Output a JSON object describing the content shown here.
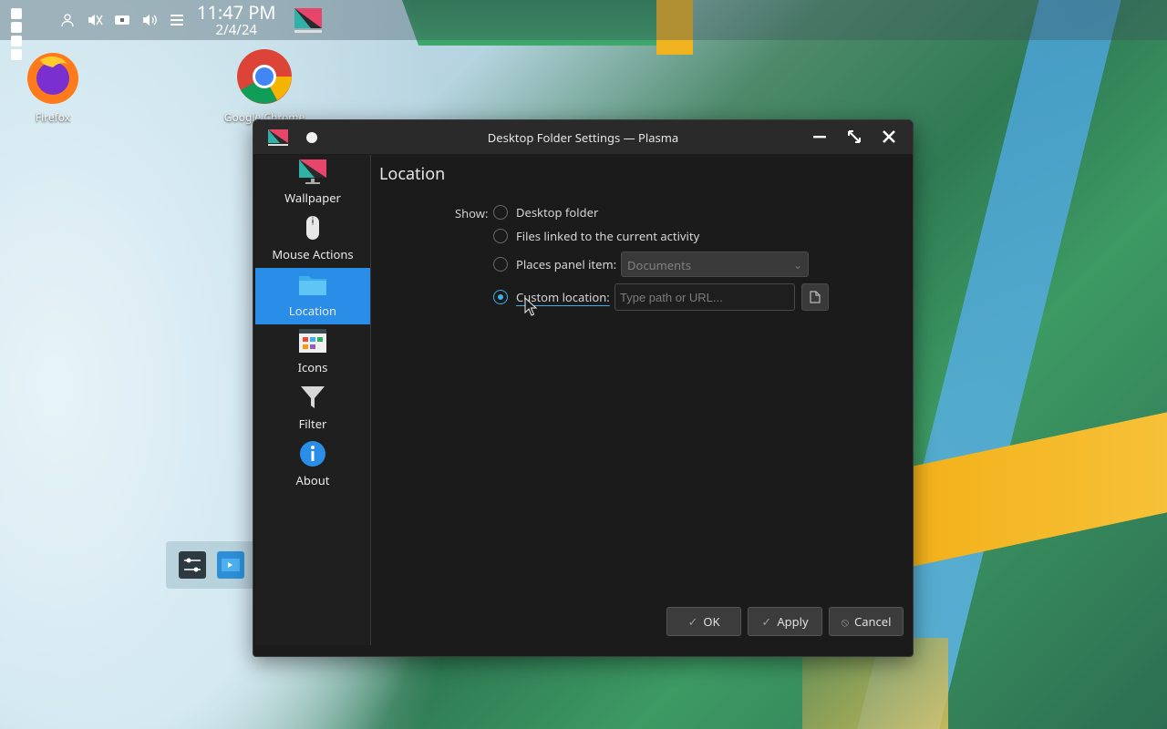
{
  "panel": {
    "time": "11:47 PM",
    "date": "2/4/24",
    "tray_icons": [
      "user-icon",
      "mute-icon",
      "network-icon",
      "volume-icon",
      "menu-icon"
    ]
  },
  "desktop": {
    "icons": [
      {
        "label": "Firefox",
        "icon": "firefox-icon"
      },
      {
        "label": "Google Chrome",
        "icon": "chrome-icon"
      }
    ]
  },
  "dialog": {
    "title": "Desktop Folder Settings — Plasma",
    "sidebar": [
      {
        "label": "Wallpaper",
        "icon": "wallpaper-icon",
        "active": false
      },
      {
        "label": "Mouse Actions",
        "icon": "mouse-icon",
        "active": false
      },
      {
        "label": "Location",
        "icon": "folder-icon",
        "active": true
      },
      {
        "label": "Icons",
        "icon": "icons-icon",
        "active": false
      },
      {
        "label": "Filter",
        "icon": "filter-icon",
        "active": false
      },
      {
        "label": "About",
        "icon": "info-icon",
        "active": false
      }
    ],
    "page_title": "Location",
    "show_label": "Show:",
    "options": {
      "desktop_folder": "Desktop folder",
      "files_linked": "Files linked to the current activity",
      "places_panel": "Places panel item:",
      "custom_location": "Custom location:"
    },
    "selected_option": "custom_location",
    "places_combo_value": "Documents",
    "custom_path_placeholder": "Type path or URL...",
    "buttons": {
      "ok": "OK",
      "apply": "Apply",
      "cancel": "Cancel"
    }
  },
  "colors": {
    "accent": "#3daee9",
    "selection": "#2a8ee8"
  }
}
